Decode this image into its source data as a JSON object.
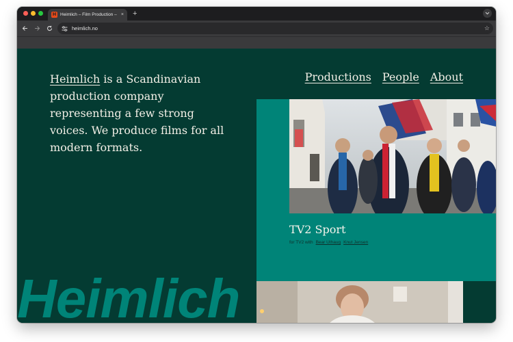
{
  "browser": {
    "tab_title": "Heimlich – Film Production – ",
    "tab_favicon_letter": "H",
    "new_tab_symbol": "+",
    "close_symbol": "×",
    "url": "heimlich.no",
    "accent_favicon_color": "#e64a19"
  },
  "site": {
    "brand": "Heimlich",
    "intro_rest": " is a Scandinavian production company representing a few strong voices. We produce films for all modern formats.",
    "nav": [
      "Productions",
      "People",
      "About"
    ],
    "background_color": "#043b32",
    "accent_color": "#008478",
    "big_wordmark": "Heimlich"
  },
  "production": {
    "title": "TV2 Sport",
    "credits_prefix": "for TV2 with",
    "credits": [
      "Bear Uthaug",
      "Knut Jensen"
    ]
  }
}
